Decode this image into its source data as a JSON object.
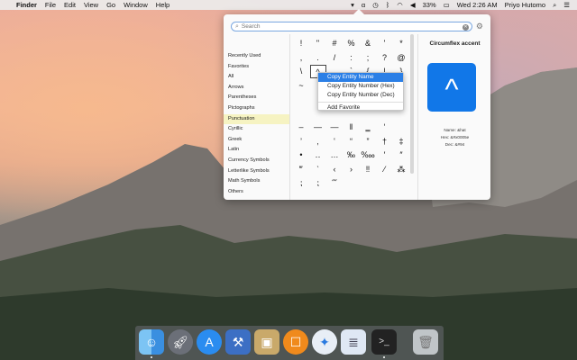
{
  "menubar": {
    "app": "Finder",
    "items": [
      "File",
      "Edit",
      "View",
      "Go",
      "Window",
      "Help"
    ],
    "battery": "33%",
    "clock": "Wed 2:26 AM",
    "user": "Priyo Hutomo",
    "status_alpha": "α"
  },
  "search": {
    "placeholder": "Search",
    "value": ""
  },
  "sidebar": {
    "items": [
      "Recently Used",
      "Favorites",
      "All",
      "Arrows",
      "Parentheses",
      "Pictographs",
      "Punctuation",
      "Cyrillic",
      "Greek",
      "Latin",
      "Currency Symbols",
      "Letterlike Symbols",
      "Math Symbols",
      "Others"
    ],
    "active": "Punctuation"
  },
  "grid": {
    "rows": [
      [
        "!",
        "\"",
        "#",
        "%",
        "&",
        "'",
        "*"
      ],
      [
        ",",
        ".",
        "/",
        ":",
        ";",
        "?",
        "@"
      ],
      [
        "\\",
        "^",
        "_",
        "`",
        "{",
        "|",
        "}"
      ],
      [
        "~",
        "¡",
        "§",
        "¶",
        "·",
        "¿",
        "‐"
      ],
      [
        "",
        "",
        "",
        "",
        "",
        "",
        ""
      ],
      [
        "",
        "",
        "",
        "",
        "",
        "",
        ""
      ],
      [
        "–",
        "—",
        "―",
        "‖",
        "‗",
        "‘",
        ""
      ],
      [
        "’",
        "‚",
        "‛",
        "“",
        "”",
        "†",
        "‡"
      ],
      [
        "•",
        "‥",
        "…",
        "‰",
        "‱",
        "′",
        "″"
      ],
      [
        "‴",
        "‵",
        "‹",
        "›",
        "‼",
        "⁄",
        "⁂"
      ],
      [
        "⁏",
        "⁏",
        "⁗",
        "",
        "",
        "",
        ""
      ]
    ],
    "selected": "^"
  },
  "detail": {
    "title": "Circumflex accent",
    "glyph": "^",
    "name_line": "Name: &hat",
    "hex_line": "Hex: &#x0005e",
    "dec_line": "Dec: &#94"
  },
  "context_menu": {
    "items": [
      "Copy Entity Name",
      "Copy Entity Number (Hex)",
      "Copy Entity Number (Dec)"
    ],
    "extra": "Add Favorite"
  },
  "dock": {
    "apps": [
      "Finder",
      "Launchpad",
      "App Store",
      "Xcode",
      "Preview",
      "iBooks",
      "Safari",
      "TextEdit",
      "Terminal",
      "Trash"
    ]
  },
  "colors": {
    "accent": "#2b7fe6",
    "preview_bg": "#1177e8",
    "sidebar_active": "#f6f3c2"
  }
}
